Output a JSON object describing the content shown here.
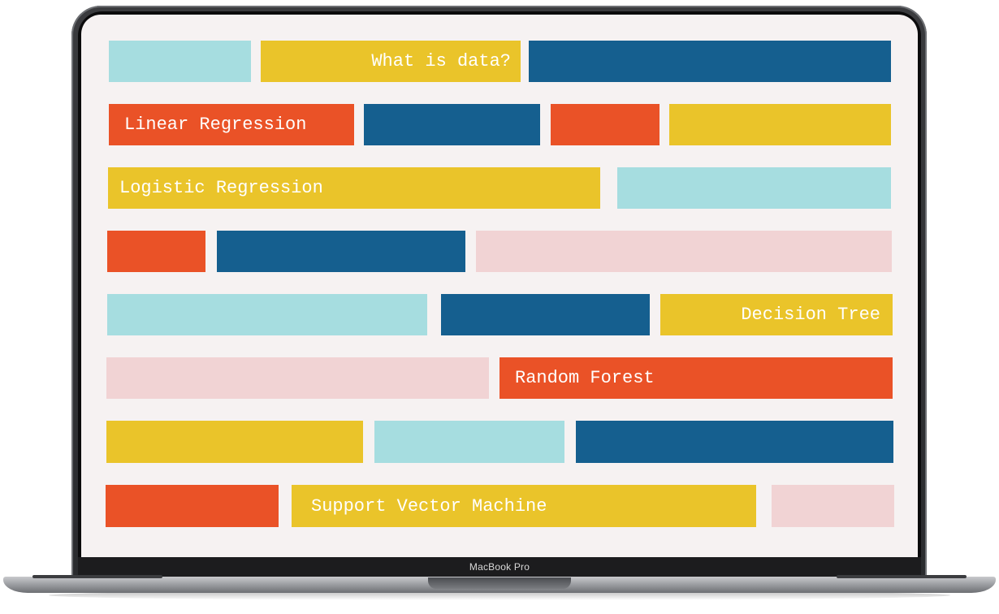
{
  "device": {
    "model_label": "MacBook Pro"
  },
  "slide": {
    "topics": [
      "What is data?",
      "Linear Regression",
      "Logistic Regression",
      "Decision Tree",
      "Random Forest",
      "Support Vector Machine"
    ]
  },
  "colors": {
    "teal": "#a6dde0",
    "yellow": "#eac42a",
    "blue": "#155f8f",
    "orange": "#ea5227",
    "pink": "#f1d3d4",
    "screen_background": "#f6f2f2",
    "label_text": "#ffffff"
  }
}
